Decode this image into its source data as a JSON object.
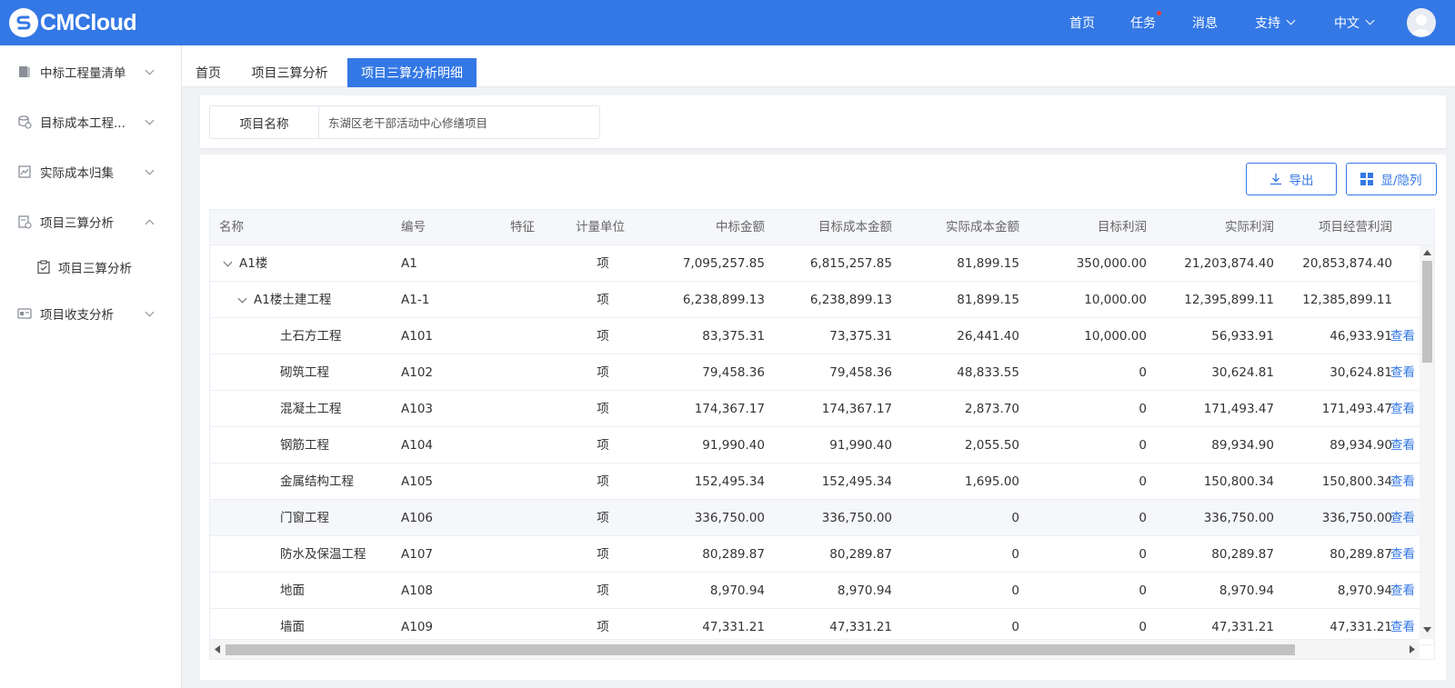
{
  "header": {
    "logo_text": "CMCloud",
    "nav": {
      "home": "首页",
      "tasks": "任务",
      "messages": "消息",
      "support": "支持",
      "language": "中文"
    }
  },
  "sidebar": {
    "items": [
      {
        "label": "中标工程量清单",
        "icon": "book-icon"
      },
      {
        "label": "目标成本工程...",
        "icon": "database-icon"
      },
      {
        "label": "实际成本归集",
        "icon": "chart-icon"
      },
      {
        "label": "项目三算分析",
        "icon": "analysis-icon"
      },
      {
        "label": "项目三算分析",
        "icon": "clipboard-icon"
      },
      {
        "label": "项目收支分析",
        "icon": "card-icon"
      }
    ]
  },
  "tabs": [
    "首页",
    "项目三算分析",
    "项目三算分析明细"
  ],
  "filter": {
    "label": "项目名称",
    "value": "东湖区老干部活动中心修缮项目"
  },
  "toolbar": {
    "export": "导出",
    "columns": "显/隐列"
  },
  "table": {
    "headers": [
      "名称",
      "编号",
      "特征",
      "计量单位",
      "中标金额",
      "目标成本金额",
      "实际成本金额",
      "目标利润",
      "实际利润",
      "项目经营利润"
    ],
    "rows": [
      {
        "name": "A1楼",
        "code": "A1",
        "unit": "项",
        "bid": "7,095,257.85",
        "target": "6,815,257.85",
        "actual": "81,899.15",
        "target_profit": "350,000.00",
        "actual_profit": "21,203,874.40",
        "op_profit": "20,853,874.40",
        "action": ""
      },
      {
        "name": "A1楼土建工程",
        "code": "A1-1",
        "unit": "项",
        "bid": "6,238,899.13",
        "target": "6,238,899.13",
        "actual": "81,899.15",
        "target_profit": "10,000.00",
        "actual_profit": "12,395,899.11",
        "op_profit": "12,385,899.11",
        "action": ""
      },
      {
        "name": "土石方工程",
        "code": "A101",
        "unit": "项",
        "bid": "83,375.31",
        "target": "73,375.31",
        "actual": "26,441.40",
        "target_profit": "10,000.00",
        "actual_profit": "56,933.91",
        "op_profit": "46,933.91",
        "action": "查看"
      },
      {
        "name": "砌筑工程",
        "code": "A102",
        "unit": "项",
        "bid": "79,458.36",
        "target": "79,458.36",
        "actual": "48,833.55",
        "target_profit": "0",
        "actual_profit": "30,624.81",
        "op_profit": "30,624.81",
        "action": "查看"
      },
      {
        "name": "混凝土工程",
        "code": "A103",
        "unit": "项",
        "bid": "174,367.17",
        "target": "174,367.17",
        "actual": "2,873.70",
        "target_profit": "0",
        "actual_profit": "171,493.47",
        "op_profit": "171,493.47",
        "action": "查看"
      },
      {
        "name": "钢筋工程",
        "code": "A104",
        "unit": "项",
        "bid": "91,990.40",
        "target": "91,990.40",
        "actual": "2,055.50",
        "target_profit": "0",
        "actual_profit": "89,934.90",
        "op_profit": "89,934.90",
        "action": "查看"
      },
      {
        "name": "金属结构工程",
        "code": "A105",
        "unit": "项",
        "bid": "152,495.34",
        "target": "152,495.34",
        "actual": "1,695.00",
        "target_profit": "0",
        "actual_profit": "150,800.34",
        "op_profit": "150,800.34",
        "action": "查看"
      },
      {
        "name": "门窗工程",
        "code": "A106",
        "unit": "项",
        "bid": "336,750.00",
        "target": "336,750.00",
        "actual": "0",
        "target_profit": "0",
        "actual_profit": "336,750.00",
        "op_profit": "336,750.00",
        "action": "查看"
      },
      {
        "name": "防水及保温工程",
        "code": "A107",
        "unit": "项",
        "bid": "80,289.87",
        "target": "80,289.87",
        "actual": "0",
        "target_profit": "0",
        "actual_profit": "80,289.87",
        "op_profit": "80,289.87",
        "action": "查看"
      },
      {
        "name": "地面",
        "code": "A108",
        "unit": "项",
        "bid": "8,970.94",
        "target": "8,970.94",
        "actual": "0",
        "target_profit": "0",
        "actual_profit": "8,970.94",
        "op_profit": "8,970.94",
        "action": "查看"
      },
      {
        "name": "墙面",
        "code": "A109",
        "unit": "项",
        "bid": "47,331.21",
        "target": "47,331.21",
        "actual": "0",
        "target_profit": "0",
        "actual_profit": "47,331.21",
        "op_profit": "47,331.21",
        "action": "查看"
      }
    ]
  },
  "colors": {
    "primary": "#3478e5",
    "notification_dot": "#ff3b30"
  }
}
